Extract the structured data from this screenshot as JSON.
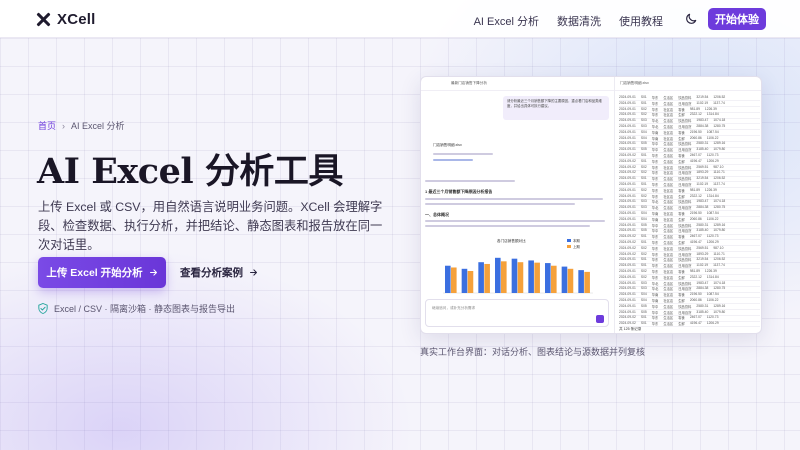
{
  "nav": {
    "logo": "XCell",
    "links": [
      "AI Excel 分析",
      "数据清洗",
      "使用教程"
    ],
    "cta": "开始体验",
    "theme_icon": "moon-icon",
    "logo_icon": "x-logo-icon"
  },
  "hero": {
    "breadcrumb": {
      "home": "首页",
      "separator": "›",
      "current": "AI Excel 分析"
    },
    "title": "AI Excel 分析工具",
    "subtitle": "上传 Excel 或 CSV，用自然语言说明业务问题。XCell 会理解字段、检查数据、执行分析，并把结论、静态图表和报告放在同一次对话里。",
    "primary_button": "上传 Excel 开始分析",
    "secondary_button": "查看分析案例",
    "features": "Excel / CSV · 隔离沙箱 · 静态图表与报告导出",
    "colors": {
      "accent": "#6d3bdc",
      "bar_blue": "#3b6fe0",
      "bar_orange": "#f5a13b"
    }
  },
  "screenshot": {
    "chat_header": "最新门店销售下降分析",
    "user_message": "请分析最近三个月销售额下降的主要原因，重点看门店和品类维度，并给出具体可执行建议。",
    "doc_name": "门店销售明细.xlsx",
    "report_title": "1 最近三个月销售额下降原因分析报告",
    "section_title": "一、总体概况",
    "chart_legend": [
      "本期",
      "上期"
    ],
    "input_placeholder": "继续追问，或补充分析需求",
    "table_header": "门店销售明细.xlsx",
    "table_rows": [
      [
        "2024-09-01",
        "S01",
        "华东",
        "生活区",
        "饮品饮料",
        "3219.54",
        "1206.52"
      ],
      [
        "2024-09-01",
        "S01",
        "华东",
        "生活区",
        "日用百货",
        "1102.19",
        "1137.74"
      ],
      [
        "2024-09-01",
        "S02",
        "华东",
        "社区店",
        "零食",
        "981.89",
        "1226.39"
      ],
      [
        "2024-09-01",
        "S02",
        "华东",
        "社区店",
        "生鲜",
        "2322.12",
        "1314.84"
      ],
      [
        "2024-09-01",
        "S03",
        "华北",
        "生活区",
        "饮品饮料",
        "1983.47",
        "1074.18"
      ],
      [
        "2024-09-01",
        "S03",
        "华北",
        "生活区",
        "日用百货",
        "2884.38",
        "1280.75"
      ],
      [
        "2024-09-01",
        "S04",
        "华南",
        "社区店",
        "零食",
        "2196.50",
        "1087.54"
      ],
      [
        "2024-09-01",
        "S04",
        "华南",
        "社区店",
        "生鲜",
        "2060.86",
        "1106.22"
      ],
      [
        "2024-09-01",
        "S05",
        "华中",
        "生活区",
        "饮品饮料",
        "2580.31",
        "1289.16"
      ],
      [
        "2024-09-01",
        "S05",
        "华中",
        "生活区",
        "日用百货",
        "3185.40",
        "1079.80"
      ],
      [
        "2024-09-02",
        "S01",
        "华东",
        "生活区",
        "零食",
        "2467.07",
        "1120.73"
      ],
      [
        "2024-09-02",
        "S01",
        "华东",
        "生活区",
        "生鲜",
        "4196.47",
        "1206.29"
      ],
      [
        "2024-09-02",
        "S02",
        "华东",
        "社区店",
        "饮品饮料",
        "2569.51",
        "987.10"
      ],
      [
        "2024-09-02",
        "S02",
        "华东",
        "社区店",
        "日用百货",
        "1893.29",
        "1110.71"
      ]
    ],
    "table_footer": "共 125 条记录"
  },
  "caption": "真实工作台界面：对话分析、图表结论与源数据并列复核",
  "chart_data": {
    "type": "bar",
    "title": "各门店销售额对比",
    "categories": [
      "S01",
      "S02",
      "S03",
      "S04",
      "S05",
      "S06",
      "S07",
      "S08",
      "S09"
    ],
    "series": [
      {
        "name": "本期",
        "values": [
          62,
          55,
          70,
          80,
          78,
          74,
          68,
          60,
          52
        ]
      },
      {
        "name": "上期",
        "values": [
          58,
          50,
          66,
          72,
          70,
          69,
          62,
          55,
          48
        ]
      }
    ],
    "ylim": [
      0,
      100
    ]
  }
}
